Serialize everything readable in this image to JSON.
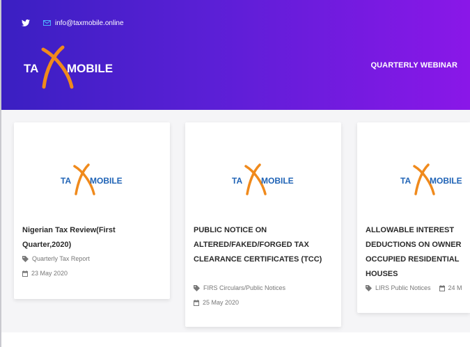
{
  "header": {
    "email": "info@taxmobile.online",
    "logo_text": "TAXMOBILE",
    "nav": [
      "QUARTERLY WEBINAR"
    ]
  },
  "posts": [
    {
      "title": "Nigerian Tax Review(First Quarter,2020)",
      "category": "Quarterly Tax Report",
      "date": "23 May 2020"
    },
    {
      "title": "PUBLIC NOTICE ON ALTERED/FAKED/FORGED TAX CLEARANCE CERTIFICATES (TCC)",
      "category": "FIRS Circulars/Public Notices",
      "date": "25 May 2020"
    },
    {
      "title": "ALLOWABLE INTEREST DEDUCTIONS ON OWNER OCCUPIED RESIDENTIAL HOUSES",
      "category": "LIRS Public Notices",
      "date": "24 M"
    }
  ],
  "colors": {
    "header_start": "#3a1fc2",
    "header_end": "#8a17e8",
    "logo_orange": "#f08a1c",
    "logo_blue": "#1f63b6"
  },
  "icons": [
    "twitter-icon",
    "mail-icon",
    "tag-icon",
    "calendar-icon"
  ]
}
